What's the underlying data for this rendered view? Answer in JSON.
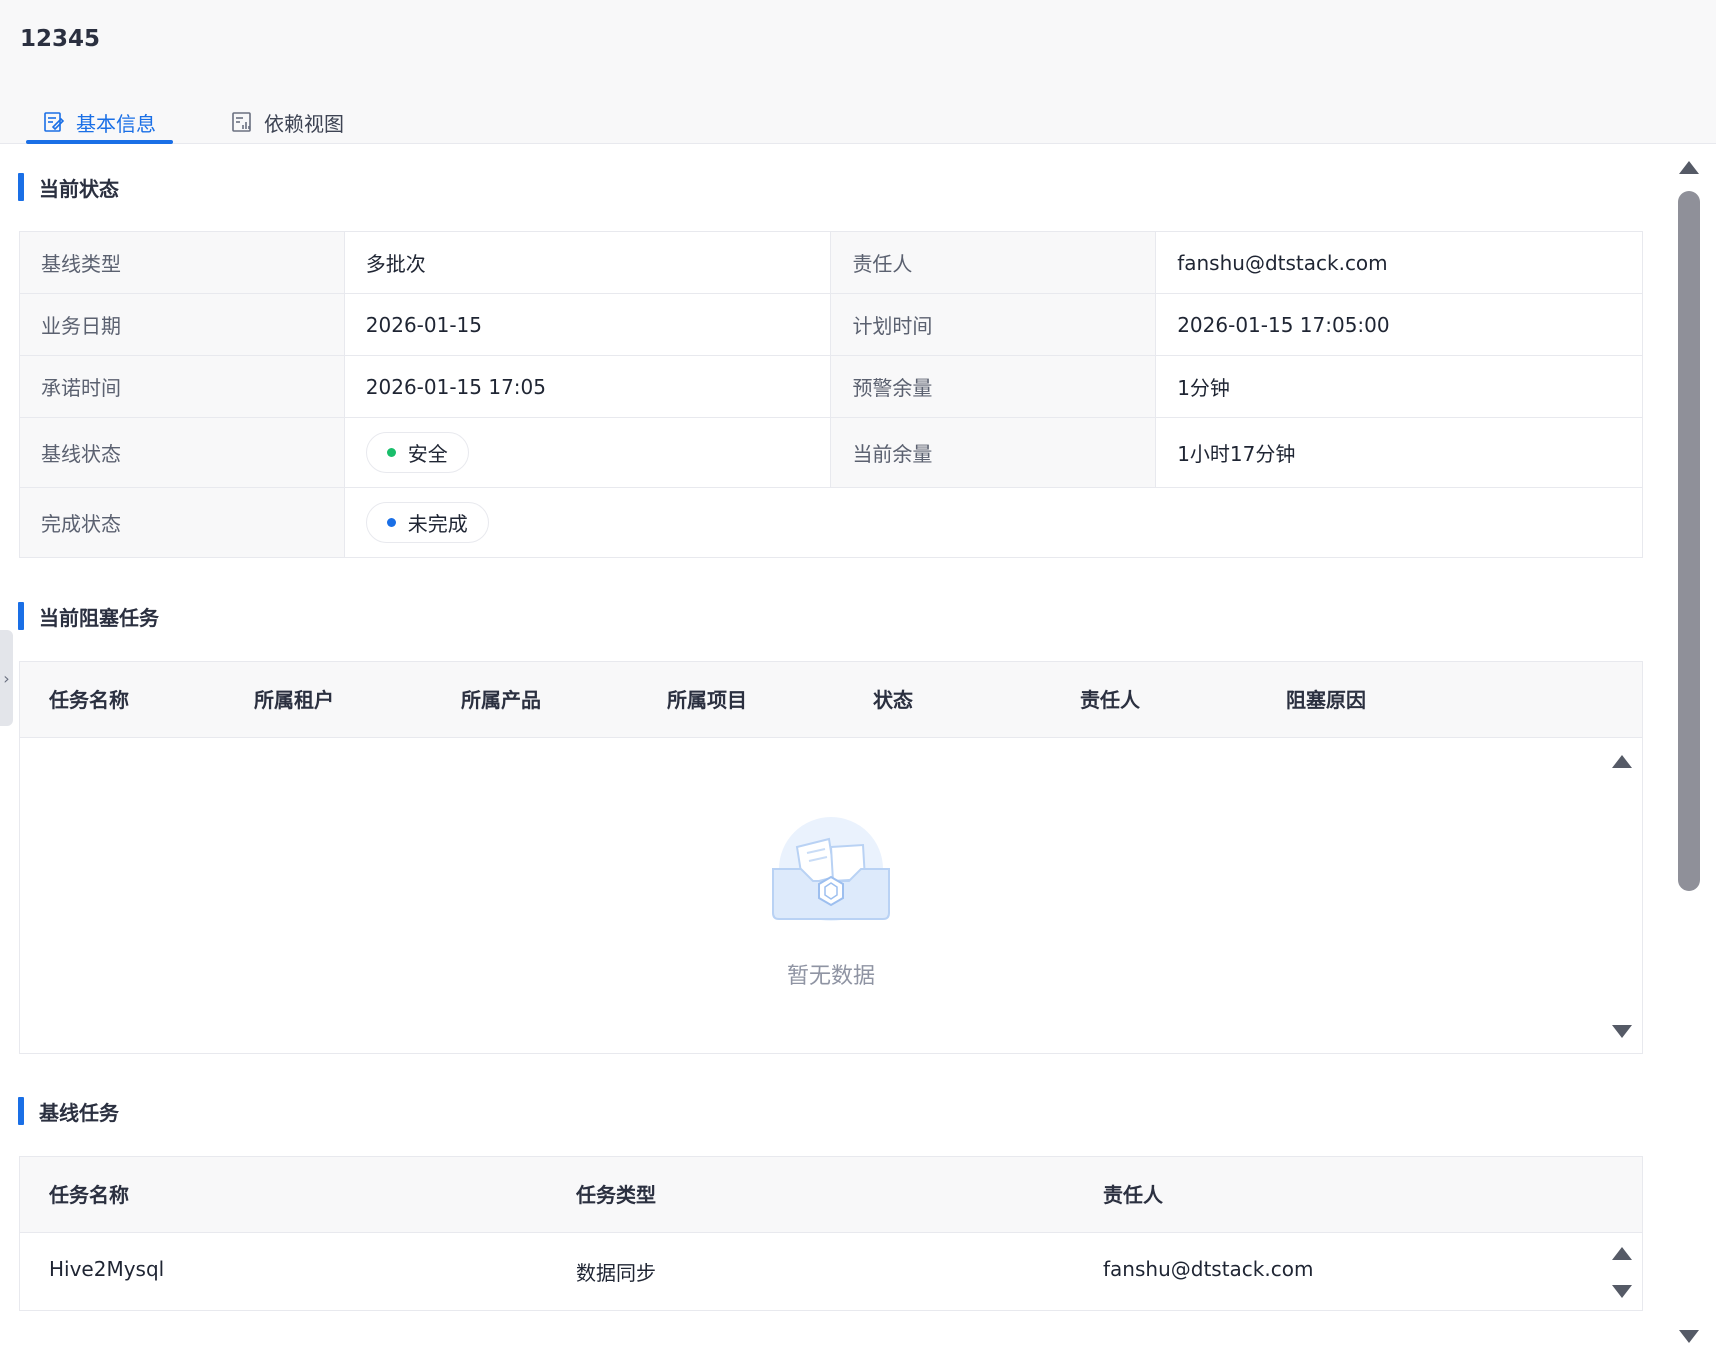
{
  "page": {
    "title": "12345"
  },
  "tabs": [
    {
      "label": "基本信息",
      "active": true,
      "icon": "edit-doc-icon"
    },
    {
      "label": "依赖视图",
      "active": false,
      "icon": "chart-doc-icon"
    }
  ],
  "sections": {
    "status": "当前状态",
    "blocked": "当前阻塞任务",
    "baseline": "基线任务"
  },
  "info": {
    "baseline_type": {
      "label": "基线类型",
      "value": "多批次"
    },
    "owner": {
      "label": "责任人",
      "value": "fanshu@dtstack.com"
    },
    "biz_date": {
      "label": "业务日期",
      "value": "2026-01-15"
    },
    "plan_time": {
      "label": "计划时间",
      "value": "2026-01-15 17:05:00"
    },
    "promise_time": {
      "label": "承诺时间",
      "value": "2026-01-15 17:05"
    },
    "warning_margin": {
      "label": "预警余量",
      "value": "1分钟"
    },
    "baseline_status": {
      "label": "基线状态",
      "value": "安全",
      "color": "#19be6b"
    },
    "current_margin": {
      "label": "当前余量",
      "value": "1小时17分钟"
    },
    "complete_status": {
      "label": "完成状态",
      "value": "未完成",
      "color": "#1a6fe6"
    }
  },
  "blocked_table": {
    "columns": [
      "任务名称",
      "所属租户",
      "所属产品",
      "所属项目",
      "状态",
      "责任人",
      "阻塞原因"
    ],
    "empty_text": "暂无数据"
  },
  "baseline_table": {
    "columns": [
      "任务名称",
      "任务类型",
      "责任人"
    ],
    "rows": [
      [
        "Hive2Mysql",
        "数据同步",
        "fanshu@dtstack.com"
      ]
    ]
  },
  "colors": {
    "accent": "#1a6fe6",
    "safe": "#19be6b"
  }
}
